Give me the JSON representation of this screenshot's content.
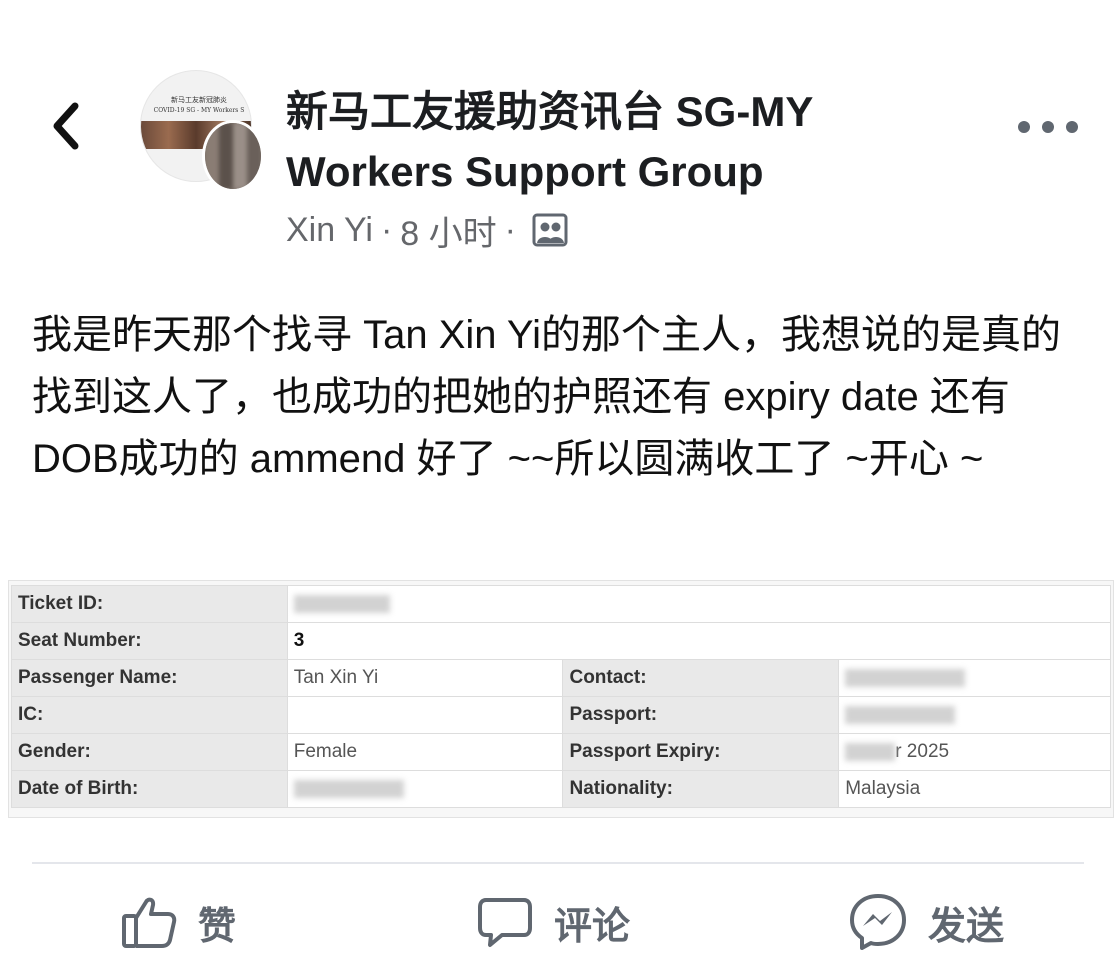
{
  "header": {
    "group_name": "新马工友援助资讯台 SG-MY Workers Support Group",
    "author": "Xin Yi",
    "time": "8 小时",
    "separator": "·",
    "avatar_text_line1": "新马工友新冠肺炎",
    "avatar_text_line2": "COVID-19 SG - MY Workers S"
  },
  "post": {
    "text": "我是昨天那个找寻 Tan Xin Yi的那个主人，我想说的是真的找到这人了，也成功的把她的护照还有 expiry date 还有 DOB成功的 ammend 好了 ~~所以圆满收工了 ~开心 ~"
  },
  "ticket": {
    "ticket_id_label": "Ticket ID:",
    "seat_label": "Seat Number:",
    "seat_value": "3",
    "name_label": "Passenger Name:",
    "name_value": "Tan Xin Yi",
    "contact_label": "Contact:",
    "ic_label": "IC:",
    "passport_label": "Passport:",
    "gender_label": "Gender:",
    "gender_value": "Female",
    "passport_expiry_label": "Passport Expiry:",
    "passport_expiry_value": "r 2025",
    "dob_label": "Date of Birth:",
    "nationality_label": "Nationality:",
    "nationality_value": "Malaysia"
  },
  "actions": {
    "like": "赞",
    "comment": "评论",
    "share": "发送"
  },
  "icons": {
    "back": "chevron-left-icon",
    "more": "more-horizontal-icon",
    "audience": "group-audience-icon",
    "like": "thumbs-up-icon",
    "comment": "comment-bubble-icon",
    "share": "messenger-icon"
  }
}
